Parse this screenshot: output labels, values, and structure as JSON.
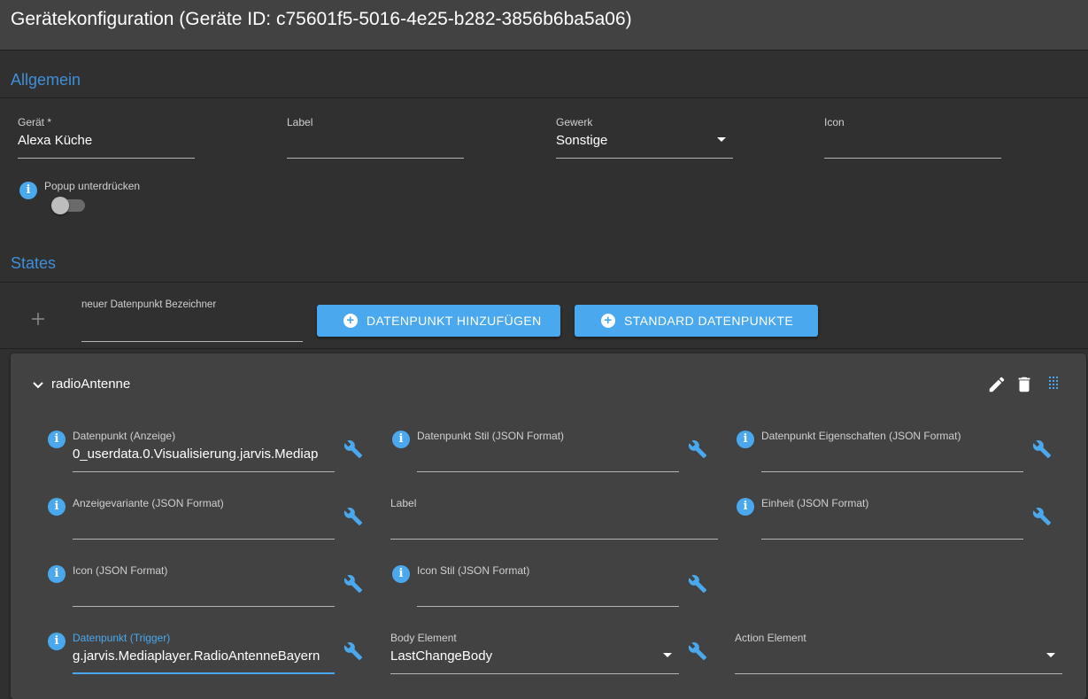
{
  "header": {
    "title": "Gerätekonfiguration (Geräte ID: c75601f5-5016-4e25-b282-3856b6ba5a06)"
  },
  "general": {
    "section_title": "Allgemein",
    "device": {
      "label": "Gerät *",
      "value": "Alexa Küche"
    },
    "label_field": {
      "label": "Label",
      "value": ""
    },
    "trade": {
      "label": "Gewerk",
      "value": "Sonstige"
    },
    "icon_field": {
      "label": "Icon",
      "value": ""
    },
    "popup_suppress": {
      "label": "Popup unterdrücken",
      "enabled": false
    }
  },
  "states": {
    "section_title": "States",
    "new_datapoint": {
      "label": "neuer Datenpunkt Bezeichner",
      "value": ""
    },
    "add_datapoint_button": "DATENPUNKT HINZUFÜGEN",
    "standard_datapoints_button": "STANDARD DATENPUNKTE",
    "item": {
      "name": "radioAntenne",
      "fields": {
        "dp_display": {
          "label": "Datenpunkt (Anzeige)",
          "value": "0_userdata.0.Visualisierung.jarvis.Mediap"
        },
        "dp_style": {
          "label": "Datenpunkt Stil (JSON Format)",
          "value": ""
        },
        "dp_props": {
          "label": "Datenpunkt Eigenschaften (JSON Format)",
          "value": ""
        },
        "display_variant": {
          "label": "Anzeigevariante (JSON Format)",
          "value": ""
        },
        "label": {
          "label": "Label",
          "value": ""
        },
        "unit": {
          "label": "Einheit (JSON Format)",
          "value": ""
        },
        "icon": {
          "label": "Icon (JSON Format)",
          "value": ""
        },
        "icon_style": {
          "label": "Icon Stil (JSON Format)",
          "value": ""
        },
        "dp_trigger": {
          "label": "Datenpunkt (Trigger)",
          "value": "g.jarvis.Mediaplayer.RadioAntenneBayern"
        },
        "body_element": {
          "label": "Body Element",
          "value": "LastChangeBody"
        },
        "action_element": {
          "label": "Action Element",
          "value": ""
        }
      }
    }
  },
  "colors": {
    "accent": "#4aa8ee",
    "section": "#3f8fd8",
    "background": "#303030",
    "card": "#424242"
  }
}
